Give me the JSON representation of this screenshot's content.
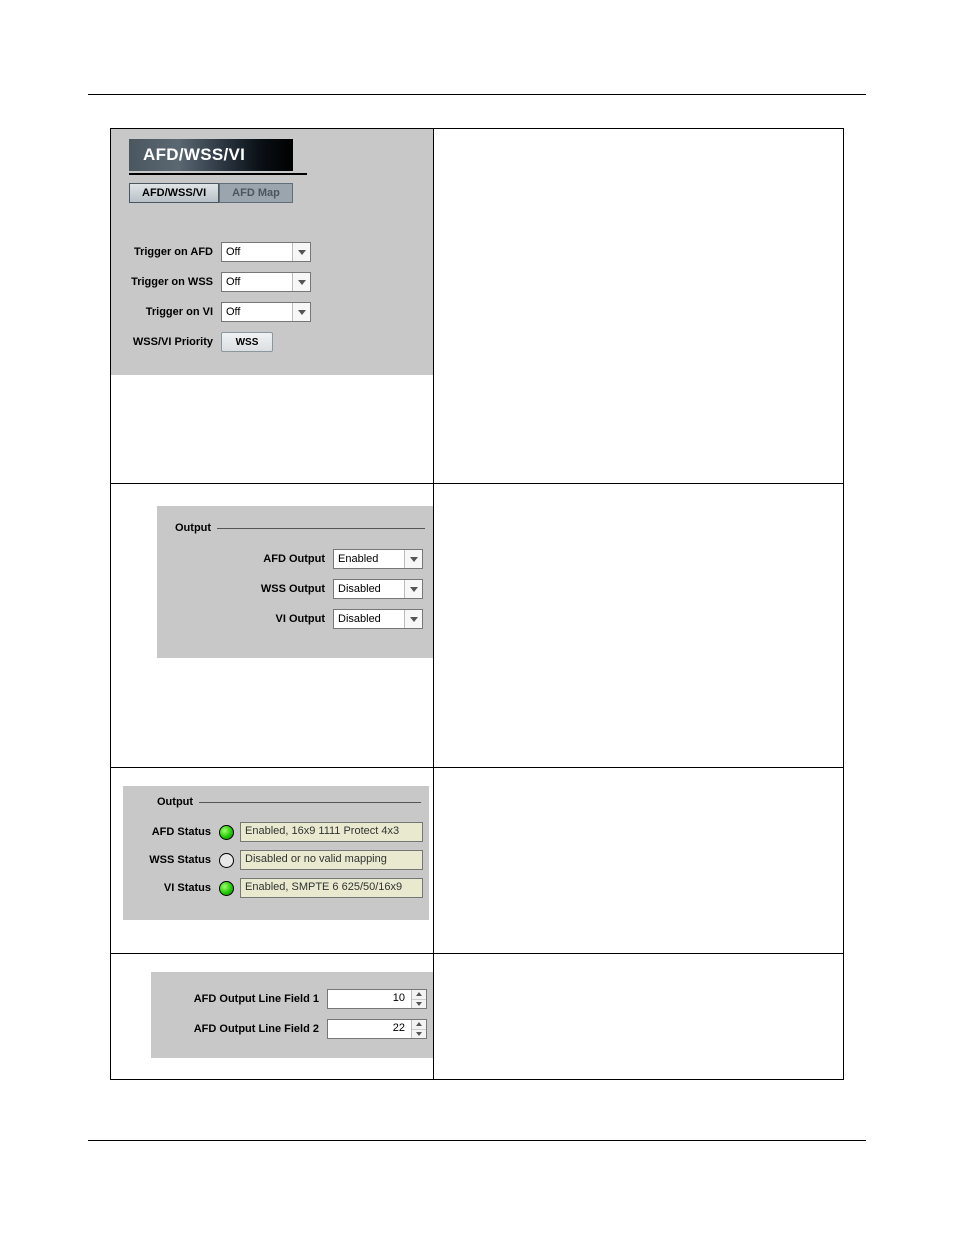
{
  "header": {
    "title": "AFD/WSS/VI",
    "tabs": {
      "tab1": "AFD/WSS/VI",
      "tab2": "AFD Map"
    }
  },
  "trigger": {
    "afd_label": "Trigger on AFD",
    "afd_value": "Off",
    "wss_label": "Trigger on WSS",
    "wss_value": "Off",
    "vi_label": "Trigger on VI",
    "vi_value": "Off",
    "priority_label": "WSS/VI Priority",
    "priority_value": "WSS"
  },
  "output_ctrl": {
    "heading": "Output",
    "afd_label": "AFD Output",
    "afd_value": "Enabled",
    "wss_label": "WSS Output",
    "wss_value": "Disabled",
    "vi_label": "VI Output",
    "vi_value": "Disabled"
  },
  "output_status": {
    "heading": "Output",
    "afd_label": "AFD Status",
    "afd_value": "Enabled, 16x9 1111 Protect 4x3",
    "wss_label": "WSS Status",
    "wss_value": "Disabled or no valid mapping",
    "vi_label": "VI Status",
    "vi_value": "Enabled, SMPTE 6 625/50/16x9"
  },
  "lines": {
    "f1_label": "AFD Output Line Field 1",
    "f1_value": "10",
    "f2_label": "AFD Output Line Field 2",
    "f2_value": "22"
  }
}
